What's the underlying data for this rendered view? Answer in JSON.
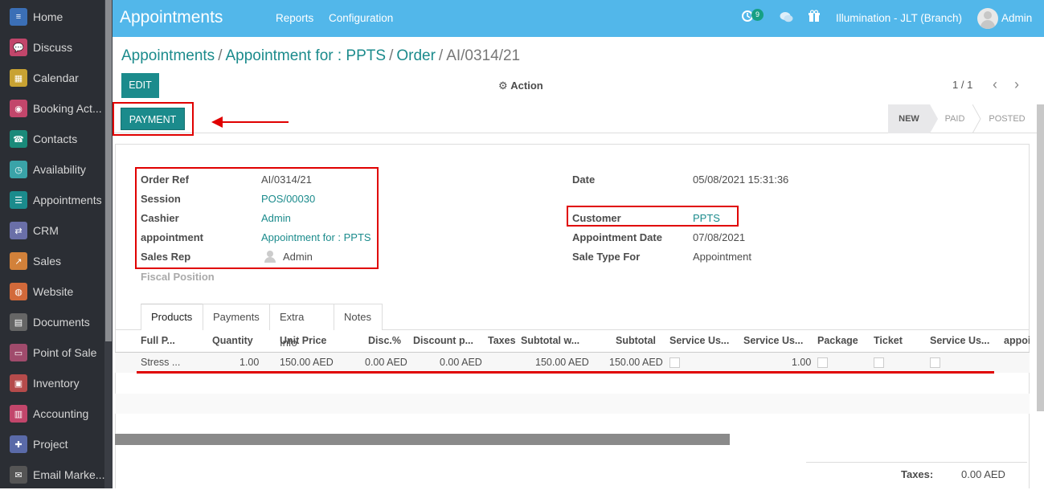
{
  "sidebar": {
    "items": [
      {
        "label": "Home",
        "icon": "home-icon",
        "color": "#3b6fb6"
      },
      {
        "label": "Discuss",
        "icon": "discuss-icon",
        "color": "#c2466b"
      },
      {
        "label": "Calendar",
        "icon": "calendar-icon",
        "color": "#c8a232"
      },
      {
        "label": "Booking Act...",
        "icon": "booking-icon",
        "color": "#c2466b"
      },
      {
        "label": "Contacts",
        "icon": "contacts-icon",
        "color": "#1a8a7a"
      },
      {
        "label": "Availability",
        "icon": "availability-icon",
        "color": "#3aa3a8"
      },
      {
        "label": "Appointments",
        "icon": "appointments-icon",
        "color": "#1b8b8c"
      },
      {
        "label": "CRM",
        "icon": "crm-icon",
        "color": "#6a6fa8"
      },
      {
        "label": "Sales",
        "icon": "sales-icon",
        "color": "#d2813a"
      },
      {
        "label": "Website",
        "icon": "website-icon",
        "color": "#d2693a"
      },
      {
        "label": "Documents",
        "icon": "documents-icon",
        "color": "#666"
      },
      {
        "label": "Point of Sale",
        "icon": "pos-icon",
        "color": "#a04b6c"
      },
      {
        "label": "Inventory",
        "icon": "inventory-icon",
        "color": "#b54b4b"
      },
      {
        "label": "Accounting",
        "icon": "accounting-icon",
        "color": "#c2466b"
      },
      {
        "label": "Project",
        "icon": "project-icon",
        "color": "#5a6aa8"
      },
      {
        "label": "Email Marke...",
        "icon": "email-marketing-icon",
        "color": "#555"
      }
    ]
  },
  "topbar": {
    "app_title": "Appointments",
    "menu": [
      "Reports",
      "Configuration"
    ],
    "activity_count": "9",
    "company": "Illumination - JLT (Branch)",
    "user": "Admin"
  },
  "breadcrumb": {
    "items": [
      "Appointments",
      "Appointment for : PPTS",
      "Order"
    ],
    "current": "AI/0314/21"
  },
  "controls": {
    "edit_label": "EDIT",
    "action_label": "Action",
    "pager": "1 / 1"
  },
  "statusbar": {
    "payment_label": "PAYMENT",
    "stages": [
      "NEW",
      "PAID",
      "POSTED"
    ],
    "active_stage": "NEW"
  },
  "form": {
    "left": [
      {
        "label": "Order Ref",
        "value": "AI/0314/21",
        "link": false
      },
      {
        "label": "Session",
        "value": "POS/00030",
        "link": true
      },
      {
        "label": "Cashier",
        "value": "Admin",
        "link": true
      },
      {
        "label": "appointment",
        "value": "Appointment for : PPTS",
        "link": true
      },
      {
        "label": "Sales Rep",
        "value": "Admin",
        "link": false
      }
    ],
    "fiscal_position_label": "Fiscal Position",
    "right": [
      {
        "label": "Date",
        "value": "05/08/2021 15:31:36",
        "link": false
      },
      {
        "label": "Customer",
        "value": "PPTS",
        "link": true
      },
      {
        "label": "Appointment Date",
        "value": "07/08/2021",
        "link": false
      },
      {
        "label": "Sale Type For",
        "value": "Appointment",
        "link": false
      }
    ]
  },
  "tabs": [
    "Products",
    "Payments",
    "Extra Info",
    "Notes"
  ],
  "active_tab": "Products",
  "table": {
    "headers": [
      "Full P...",
      "Quantity",
      "Unit Price",
      "Disc.%",
      "Discount p...",
      "Taxes",
      "Subtotal w...",
      "Subtotal",
      "Service Us...",
      "Service Us...",
      "Package",
      "Ticket",
      "Service Us...",
      "appoi"
    ],
    "row": {
      "product": "Stress ...",
      "quantity": "1.00",
      "unit_price": "150.00 AED",
      "disc": "0.00 AED",
      "discount_p": "0.00 AED",
      "subtotal_w": "150.00 AED",
      "subtotal": "150.00 AED",
      "service_us_2": "1.00"
    }
  },
  "totals": {
    "taxes_label": "Taxes:",
    "taxes_value": "0.00 AED"
  },
  "colors": {
    "topbar": "#52b7ea",
    "primary": "#1b8b8c",
    "highlight": "#e00000",
    "sidebar": "#2b2e34"
  }
}
